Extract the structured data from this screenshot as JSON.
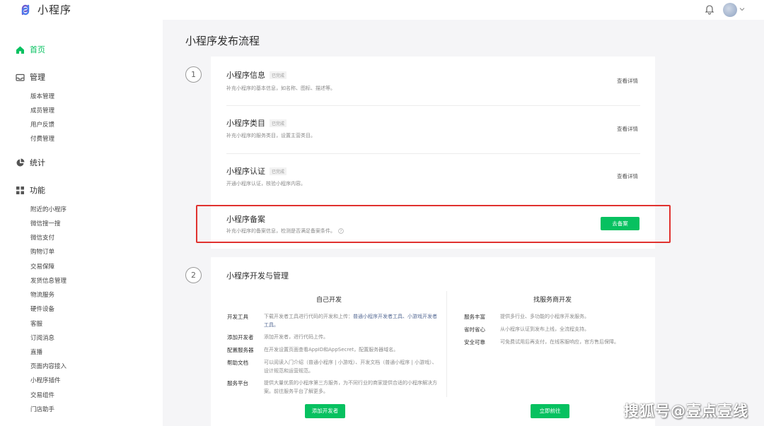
{
  "app": {
    "title": "小程序"
  },
  "sidebar": {
    "home": "首页",
    "manage": {
      "label": "管理",
      "items": [
        "版本管理",
        "成员管理",
        "用户反馈",
        "付费管理"
      ]
    },
    "stats": {
      "label": "统计"
    },
    "features": {
      "label": "功能",
      "items": [
        "附近的小程序",
        "微信搜一搜",
        "微信支付",
        "购物订单",
        "交易保障",
        "发货信息管理",
        "物流服务",
        "硬件设备",
        "客服",
        "订阅消息",
        "直播",
        "页面内容接入",
        "小程序插件",
        "交易组件",
        "门店助手"
      ]
    }
  },
  "main": {
    "title": "小程序发布流程",
    "step1": {
      "number": "1",
      "items": [
        {
          "title": "小程序信息",
          "badge": "已完成",
          "desc": "补充小程序的基本信息，如名称、图标、描述等。",
          "action": "查看详情"
        },
        {
          "title": "小程序类目",
          "badge": "已完成",
          "desc": "补充小程序的服务类目，设置主营类目。",
          "action": "查看详情"
        },
        {
          "title": "小程序认证",
          "badge": "已完成",
          "desc": "开通小程序认证，核验小程序内容。",
          "action": "查看详情"
        },
        {
          "title": "小程序备案",
          "badge": "",
          "desc": "补充小程序的备案信息，检测是否满足备案条件。",
          "action": "去备案"
        }
      ]
    },
    "step2": {
      "number": "2",
      "title": "小程序开发与管理",
      "self_dev": {
        "title": "自己开发",
        "rows": [
          {
            "label": "开发工具",
            "text": "下载开发者工具进行代码的开发和上传：",
            "link": "普通小程序开发者工具、小游戏开发者工具。"
          },
          {
            "label": "添加开发者",
            "text": "添加开发者，进行代码上传。",
            "link": ""
          },
          {
            "label": "配置服务器",
            "text": "在开发设置页面查看AppID和AppSecret，配置服务器域名。",
            "link": ""
          },
          {
            "label": "帮助文档",
            "text": "可以阅读入门介绍（普通小程序 | 小游戏）、开发文档（普通小程序 | 小游戏）、设计规范和运营规范。",
            "link": ""
          },
          {
            "label": "服务平台",
            "text": "提供大量优质的小程序第三方服务，为不同行业的商家提供合适的小程序解决方案。前往服务平台了解更多。",
            "link": ""
          }
        ],
        "button": "添加开发者"
      },
      "provider": {
        "title": "找服务商开发",
        "rows": [
          {
            "label": "服务丰富",
            "text": "提供多行业、多功能的小程序开发服务。"
          },
          {
            "label": "省时省心",
            "text": "从小程序认证到发布上线，全流程支持。"
          },
          {
            "label": "安全可靠",
            "text": "可免费试用后再支付，在线客服响应，官方售后保障。"
          }
        ],
        "button": "立即前往"
      }
    }
  },
  "watermark": "搜狐号@壹点壹线",
  "colors": {
    "accent": "#07c160",
    "highlight": "#e0322f"
  }
}
